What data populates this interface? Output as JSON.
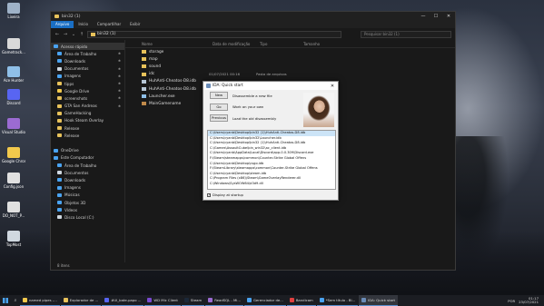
{
  "desktop": {
    "icons": [
      {
        "label": "Lixeira",
        "color": "#9fb2c8"
      },
      {
        "label": "Gametrack...",
        "color": "#d9d9d9"
      },
      {
        "label": "Ace Hunter",
        "color": "#8fbfe8"
      },
      {
        "label": "Discord",
        "color": "#5865f2"
      },
      {
        "label": "Visual Studio 2019",
        "color": "#9b6bd2"
      },
      {
        "label": "Google Chrome",
        "color": "#f2c94c"
      },
      {
        "label": "Config.json",
        "color": "#e0e0e0"
      },
      {
        "label": "DO_NOT_P...",
        "color": "#e0e0e0"
      },
      {
        "label": "TopMost",
        "color": "#d0d8e0"
      }
    ]
  },
  "explorer": {
    "title": "bin32 (1)",
    "window_controls": {
      "minimize": "—",
      "maximize": "☐",
      "close": "✕"
    },
    "ribbon_tabs": [
      "Arquivo",
      "Início",
      "Compartilhar",
      "Exibir"
    ],
    "address": "bin32 (1)",
    "search_placeholder": "Pesquisar bin32 (1)",
    "nav_pane": [
      {
        "label": "Acesso rápido",
        "icon": "star-icon",
        "color": "#4aa3f0",
        "head": true
      },
      {
        "label": "Área de Trabalho",
        "icon": "desktop-icon",
        "color": "#4aa3f0",
        "pin": true
      },
      {
        "label": "Downloads",
        "icon": "download-icon",
        "color": "#4aa3f0",
        "pin": true
      },
      {
        "label": "Documentos",
        "icon": "documents-icon",
        "color": "#cfd8e0",
        "pin": true
      },
      {
        "label": "Imagens",
        "icon": "pictures-icon",
        "color": "#4aa3f0",
        "pin": true
      },
      {
        "label": "tipps",
        "icon": "folder-icon",
        "color": "#e8c25a",
        "pin": true
      },
      {
        "label": "Google Drive",
        "icon": "google-drive-icon",
        "color": "#f2c94c",
        "pin": true
      },
      {
        "label": "screenshots",
        "icon": "folder-icon",
        "color": "#e8c25a",
        "pin": true
      },
      {
        "label": "GTA San Andreas",
        "icon": "folder-icon",
        "color": "#e8c25a",
        "pin": true
      },
      {
        "label": "GameHacking",
        "icon": "folder-icon",
        "color": "#e8c25a"
      },
      {
        "label": "Hook Steam Overlay",
        "icon": "folder-icon",
        "color": "#e8c25a"
      },
      {
        "label": "Release",
        "icon": "folder-icon",
        "color": "#e8c25a"
      },
      {
        "label": "Release",
        "icon": "folder-icon",
        "color": "#e8c25a"
      },
      {
        "label": "",
        "icon": "",
        "color": ""
      },
      {
        "label": "OneDrive",
        "icon": "onedrive-icon",
        "color": "#4aa3f0",
        "head": true
      },
      {
        "label": "Este Computador",
        "icon": "computer-icon",
        "color": "#4aa3f0",
        "head": true
      },
      {
        "label": "Área de Trabalho",
        "icon": "desktop-icon",
        "color": "#4aa3f0"
      },
      {
        "label": "Documentos",
        "icon": "documents-icon",
        "color": "#cfd8e0"
      },
      {
        "label": "Downloads",
        "icon": "download-icon",
        "color": "#4aa3f0"
      },
      {
        "label": "Imagens",
        "icon": "pictures-icon",
        "color": "#4aa3f0"
      },
      {
        "label": "Músicas",
        "icon": "music-icon",
        "color": "#4aa3f0"
      },
      {
        "label": "Objetos 3D",
        "icon": "objects-3d-icon",
        "color": "#4aa3f0"
      },
      {
        "label": "Vídeos",
        "icon": "videos-icon",
        "color": "#4aa3f0"
      },
      {
        "label": "Disco Local (C:)",
        "icon": "drive-icon",
        "color": "#cfd8e0"
      }
    ],
    "columns": [
      "Nome",
      "Data de modificação",
      "Tipo",
      "Tamanho"
    ],
    "files": [
      {
        "name": "storage",
        "date": "",
        "type": "",
        "color": "#e8c25a"
      },
      {
        "name": "map",
        "date": "",
        "type": "",
        "color": "#e8c25a"
      },
      {
        "name": "sound",
        "date": "",
        "type": "",
        "color": "#e8c25a"
      },
      {
        "name": "idc",
        "date": "",
        "type": "",
        "color": "#e8c25a"
      },
      {
        "name": "HuhAnti-Cheatos-D8.idb",
        "date": "",
        "type": "",
        "color": "#b7c7d6"
      },
      {
        "name": "HuhAnti-Cheatos-D8.idb",
        "date": "",
        "type": "",
        "color": "#b7c7d6"
      },
      {
        "name": "Launcher.exe",
        "date": "",
        "type": "",
        "color": "#8fbfe8"
      },
      {
        "name": "MainGamename",
        "date": "",
        "type": "",
        "color": "#c08a4a"
      }
    ],
    "first_row_date": "01/07/2021 00:16",
    "first_row_type": "Pasta de arquivos",
    "status": "8 itens"
  },
  "ida": {
    "title": "IDA: Quick start",
    "close": "✕",
    "buttons": [
      {
        "label": "New",
        "desc": "Disassemble a new file"
      },
      {
        "label": "Go",
        "desc": "Work on your own"
      },
      {
        "label": "Previous",
        "desc": "Load the old disassembly"
      }
    ],
    "recent_files": [
      "C:\\Users\\cyanb\\Desktop\\bin32 (1)\\HuhAnti-Cheatos-D8.idb",
      "C:\\Users\\cyanb\\Desktop\\bin32\\Launcher.idb",
      "C:\\Users\\cyanb\\Desktop\\bin32 (1)\\HuhAnti-Cheatos-D8.idb",
      "C:\\Games\\AssaultCube\\bin_win32\\ac_client.idb",
      "C:\\Users\\cyanb\\AppData\\Local\\Discord\\app-0.0.309\\Discord.exe",
      "F:\\Steam\\steamapps\\common\\Counter-Strike Global Offens",
      "C:\\Users\\cyanb\\Desktop\\csgo.idb",
      "F:\\SteamLibrary\\steamapps\\common\\Counter-Strike Global Offens",
      "C:\\Users\\cyanb\\Desktop\\steam.idb",
      "C:\\Program Files (x86)\\Steam\\GameOverlayRenderer.dll",
      "C:\\Windows\\SysWOW64\\d3d9.dll"
    ],
    "checkbox_label": "Display at startup",
    "checkbox_checked": true
  },
  "taskbar": {
    "search_glyph": "⌕",
    "tasks": [
      {
        "label": "named pipes -...",
        "color": "#f2c94c"
      },
      {
        "label": "Explorador de ...",
        "color": "#e8c25a"
      },
      {
        "label": "#UI_bate-papo ...",
        "color": "#5865f2"
      },
      {
        "label": "WD Mlc Client",
        "color": "#7a4ad0"
      },
      {
        "label": "Steam",
        "color": "#1b2838"
      },
      {
        "label": "ReadSQL - Mi...",
        "color": "#9b6bd2"
      },
      {
        "label": "Gerenciador de...",
        "color": "#4aa3f0"
      },
      {
        "label": "Bandicam",
        "color": "#e04040"
      },
      {
        "label": "*Sem título - Bl...",
        "color": "#4aa3f0"
      },
      {
        "label": "IDA: Quick start",
        "color": "#6a8cb8",
        "active": true
      }
    ],
    "lang": "POR",
    "time": "01:17",
    "date": "23/07/2021"
  }
}
